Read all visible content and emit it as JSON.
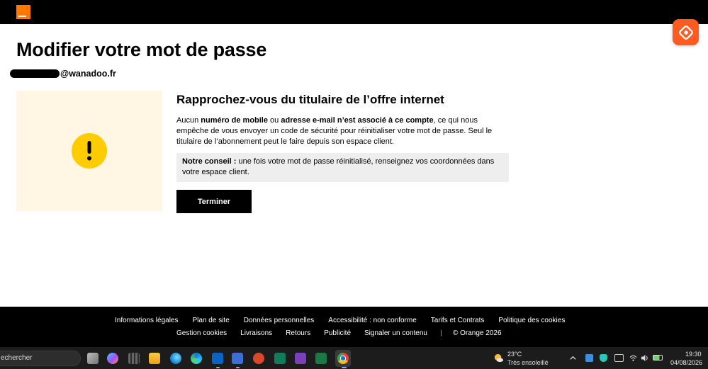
{
  "page": {
    "title": "Modifier votre mot de passe",
    "email_suffix": "@wanadoo.fr"
  },
  "content": {
    "heading": "Rapprochez-vous du titulaire de l’offre internet",
    "desc": {
      "p1": "Aucun ",
      "b1": "numéro de mobile",
      "p2": " ou ",
      "b2": "adresse e-mail n’est associé à ce compte",
      "p3": ", ce qui nous empêche de vous envoyer un code de sécurité pour réinitialiser votre mot de passe. Seul le titulaire de l’abonnement peut le faire depuis son espace client."
    },
    "tip": {
      "label": "Notre conseil :",
      "text": " une fois votre mot de passe réinitialisé, renseignez vos coordonnées dans votre espace client."
    },
    "finish_button": "Terminer"
  },
  "footer": {
    "row1": [
      "Informations légales",
      "Plan de site",
      "Données personnelles",
      "Accessibilité : non conforme",
      "Tarifs et Contrats",
      "Politique des cookies"
    ],
    "row2": [
      "Gestion cookies",
      "Livraisons",
      "Retours",
      "Publicité",
      "Signaler un contenu"
    ],
    "copyright": "© Orange 2026"
  },
  "taskbar": {
    "search_text": "echercher",
    "weather_temp": "23°C",
    "weather_desc": "Très ensoleillé",
    "time": "19:30",
    "date": "04/08/2026"
  },
  "colors": {
    "brand_orange": "#ff7900",
    "warning_yellow": "#ffcc00",
    "warning_bg": "#fff7e3"
  },
  "icons": {
    "brand": "orange-logo",
    "warning": "exclamation-icon",
    "float": "assistant-icon"
  }
}
